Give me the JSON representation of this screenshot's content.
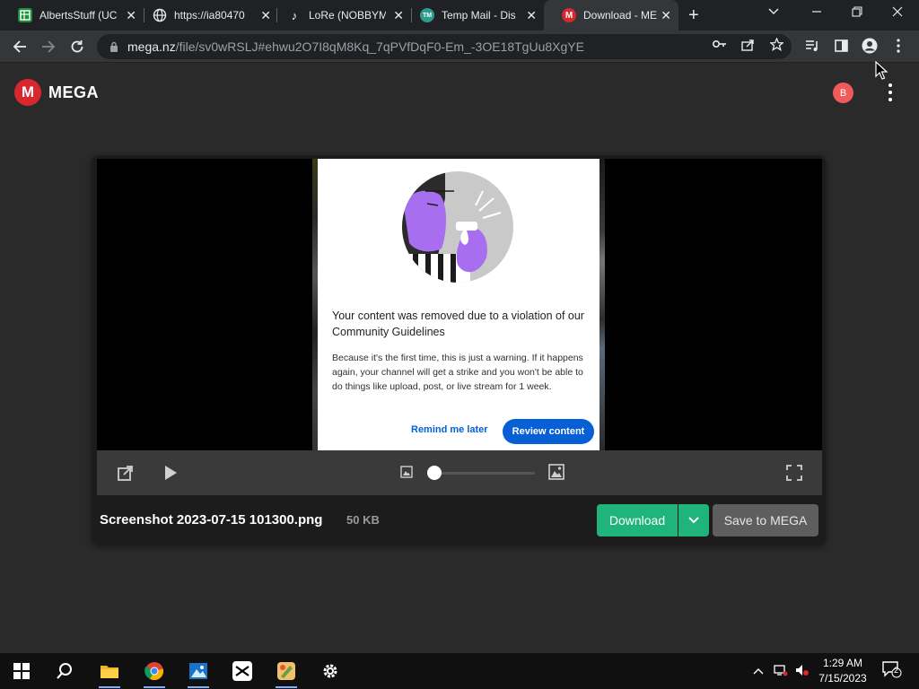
{
  "browser": {
    "tabs": [
      {
        "title": "AlbertsStuff (UC",
        "icon": "sheets-icon",
        "icon_color": "#1e8e3e",
        "active": false
      },
      {
        "title": "https://ia80470",
        "icon": "globe-icon",
        "icon_color": "#e8eaed",
        "active": false
      },
      {
        "title": "LoRe (NOBBYM",
        "icon": "tiktok-icon",
        "icon_color": "#ffffff",
        "active": false
      },
      {
        "title": "Temp Mail - Dis",
        "icon": "tempmail-icon",
        "icon_color": "#2b9d8f",
        "active": false
      },
      {
        "title": "Download - ME",
        "icon": "mega-icon",
        "icon_color": "#d9272e",
        "active": true
      }
    ],
    "address": {
      "host": "mega.nz",
      "path": "/file/sv0wRSLJ#ehwu2O7I8qM8Kq_7qPVfDqF0-Em_-3OE18TgUu8XgYE"
    }
  },
  "mega": {
    "logo_letter": "M",
    "logo_text": "MEGA",
    "avatar_initial": "B",
    "brand_color": "#d9272e"
  },
  "preview": {
    "headline": "Your content was removed due to a violation of our Community Guidelines",
    "body": "Because it's the first time, this is just a warning. If it happens again, your channel will get a strike and you won't be able to do things like upload, post, or live stream for 1 week.",
    "remind_label": "Remind me later",
    "review_label": "Review content",
    "zoom_level": 0
  },
  "file": {
    "name": "Screenshot 2023-07-15 101300.png",
    "size": "50 KB",
    "download_label": "Download",
    "save_label": "Save to MEGA",
    "download_color": "#1fb57a"
  },
  "taskbar": {
    "time": "1:29 AM",
    "date": "7/15/2023",
    "notification_count": "2"
  }
}
